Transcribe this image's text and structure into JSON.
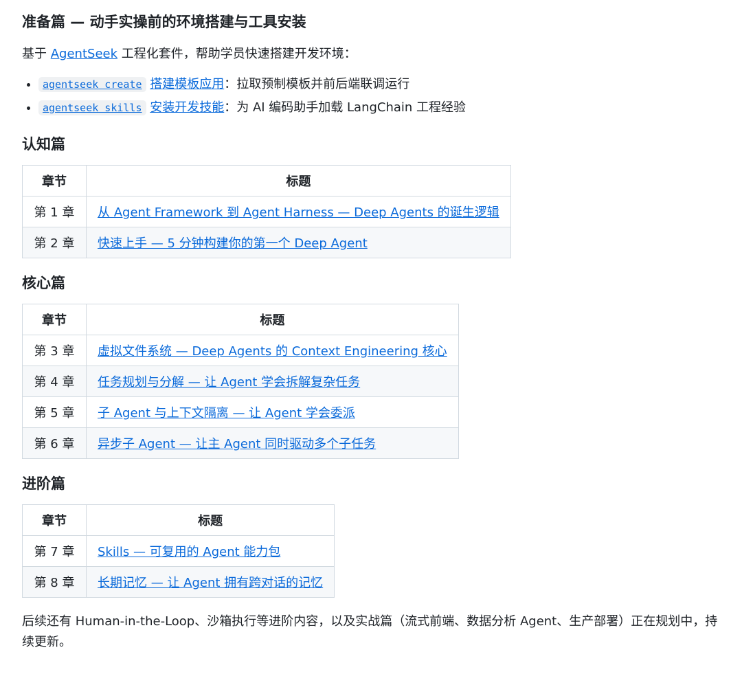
{
  "prep": {
    "title": "准备篇 — 动手实操前的环境搭建与工具安装",
    "intro_prefix": "基于",
    "intro_link": "AgentSeek",
    "intro_suffix": "工程化套件，帮助学员快速搭建开发环境：",
    "tools": [
      {
        "code": "agentseek create",
        "link": "搭建模板应用",
        "desc": "：拉取预制模板并前后端联调运行"
      },
      {
        "code": "agentseek skills",
        "link": "安装开发技能",
        "desc": "：为 AI 编码助手加载 LangChain 工程经验"
      }
    ]
  },
  "table_headers": {
    "chapter": "章节",
    "title": "标题"
  },
  "sections": [
    {
      "title": "认知篇",
      "rows": [
        {
          "chapter": "第 1 章",
          "title": "从 Agent Framework 到 Agent Harness — Deep Agents 的诞生逻辑"
        },
        {
          "chapter": "第 2 章",
          "title": "快速上手 — 5 分钟构建你的第一个 Deep Agent"
        }
      ]
    },
    {
      "title": "核心篇",
      "rows": [
        {
          "chapter": "第 3 章",
          "title": "虚拟文件系统 — Deep Agents 的 Context Engineering 核心"
        },
        {
          "chapter": "第 4 章",
          "title": "任务规划与分解 — 让 Agent 学会拆解复杂任务"
        },
        {
          "chapter": "第 5 章",
          "title": "子 Agent 与上下文隔离 — 让 Agent 学会委派"
        },
        {
          "chapter": "第 6 章",
          "title": "异步子 Agent — 让主 Agent 同时驱动多个子任务"
        }
      ]
    },
    {
      "title": "进阶篇",
      "rows": [
        {
          "chapter": "第 7 章",
          "title": "Skills — 可复用的 Agent 能力包"
        },
        {
          "chapter": "第 8 章",
          "title": "长期记忆 — 让 Agent 拥有跨对话的记忆"
        }
      ]
    }
  ],
  "outro": "后续还有 Human-in-the-Loop、沙箱执行等进阶内容，以及实战篇（流式前端、数据分析 Agent、生产部署）正在规划中，持续更新。"
}
